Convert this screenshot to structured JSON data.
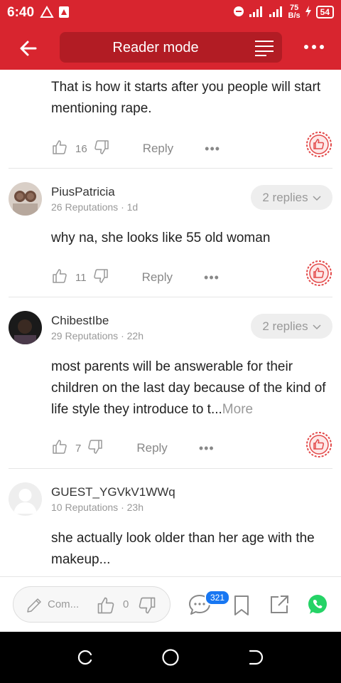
{
  "status_bar": {
    "time": "6:40",
    "net_speed_value": "75",
    "net_speed_unit": "B/s",
    "battery": "54"
  },
  "app_bar": {
    "title": "Reader mode"
  },
  "comments": [
    {
      "text": "That is how it starts after you people will start mentioning rape.",
      "likes": "16",
      "reply_label": "Reply"
    },
    {
      "username": "PiusPatricia",
      "meta": "26 Reputations · 1d",
      "replies": "2 replies",
      "text": "why na, she looks like 55 old woman",
      "likes": "11",
      "reply_label": "Reply"
    },
    {
      "username": "ChibestIbe",
      "meta": "29 Reputations · 22h",
      "replies": "2 replies",
      "text": "most parents will be answerable for their children on the last day because of the kind of life style they introduce to t...",
      "more_label": "More",
      "likes": "7",
      "reply_label": "Reply"
    },
    {
      "username": "GUEST_YGVkV1WWq",
      "meta": "10 Reputations · 23h",
      "text": "she actually look older than her age with the makeup..."
    }
  ],
  "bottom_bar": {
    "compose_placeholder": "Com...",
    "like_count": "0",
    "comment_badge": "321"
  },
  "colors": {
    "brand_red": "#d8252f",
    "whatsapp_green": "#25d366",
    "badge_blue": "#1877f2"
  }
}
